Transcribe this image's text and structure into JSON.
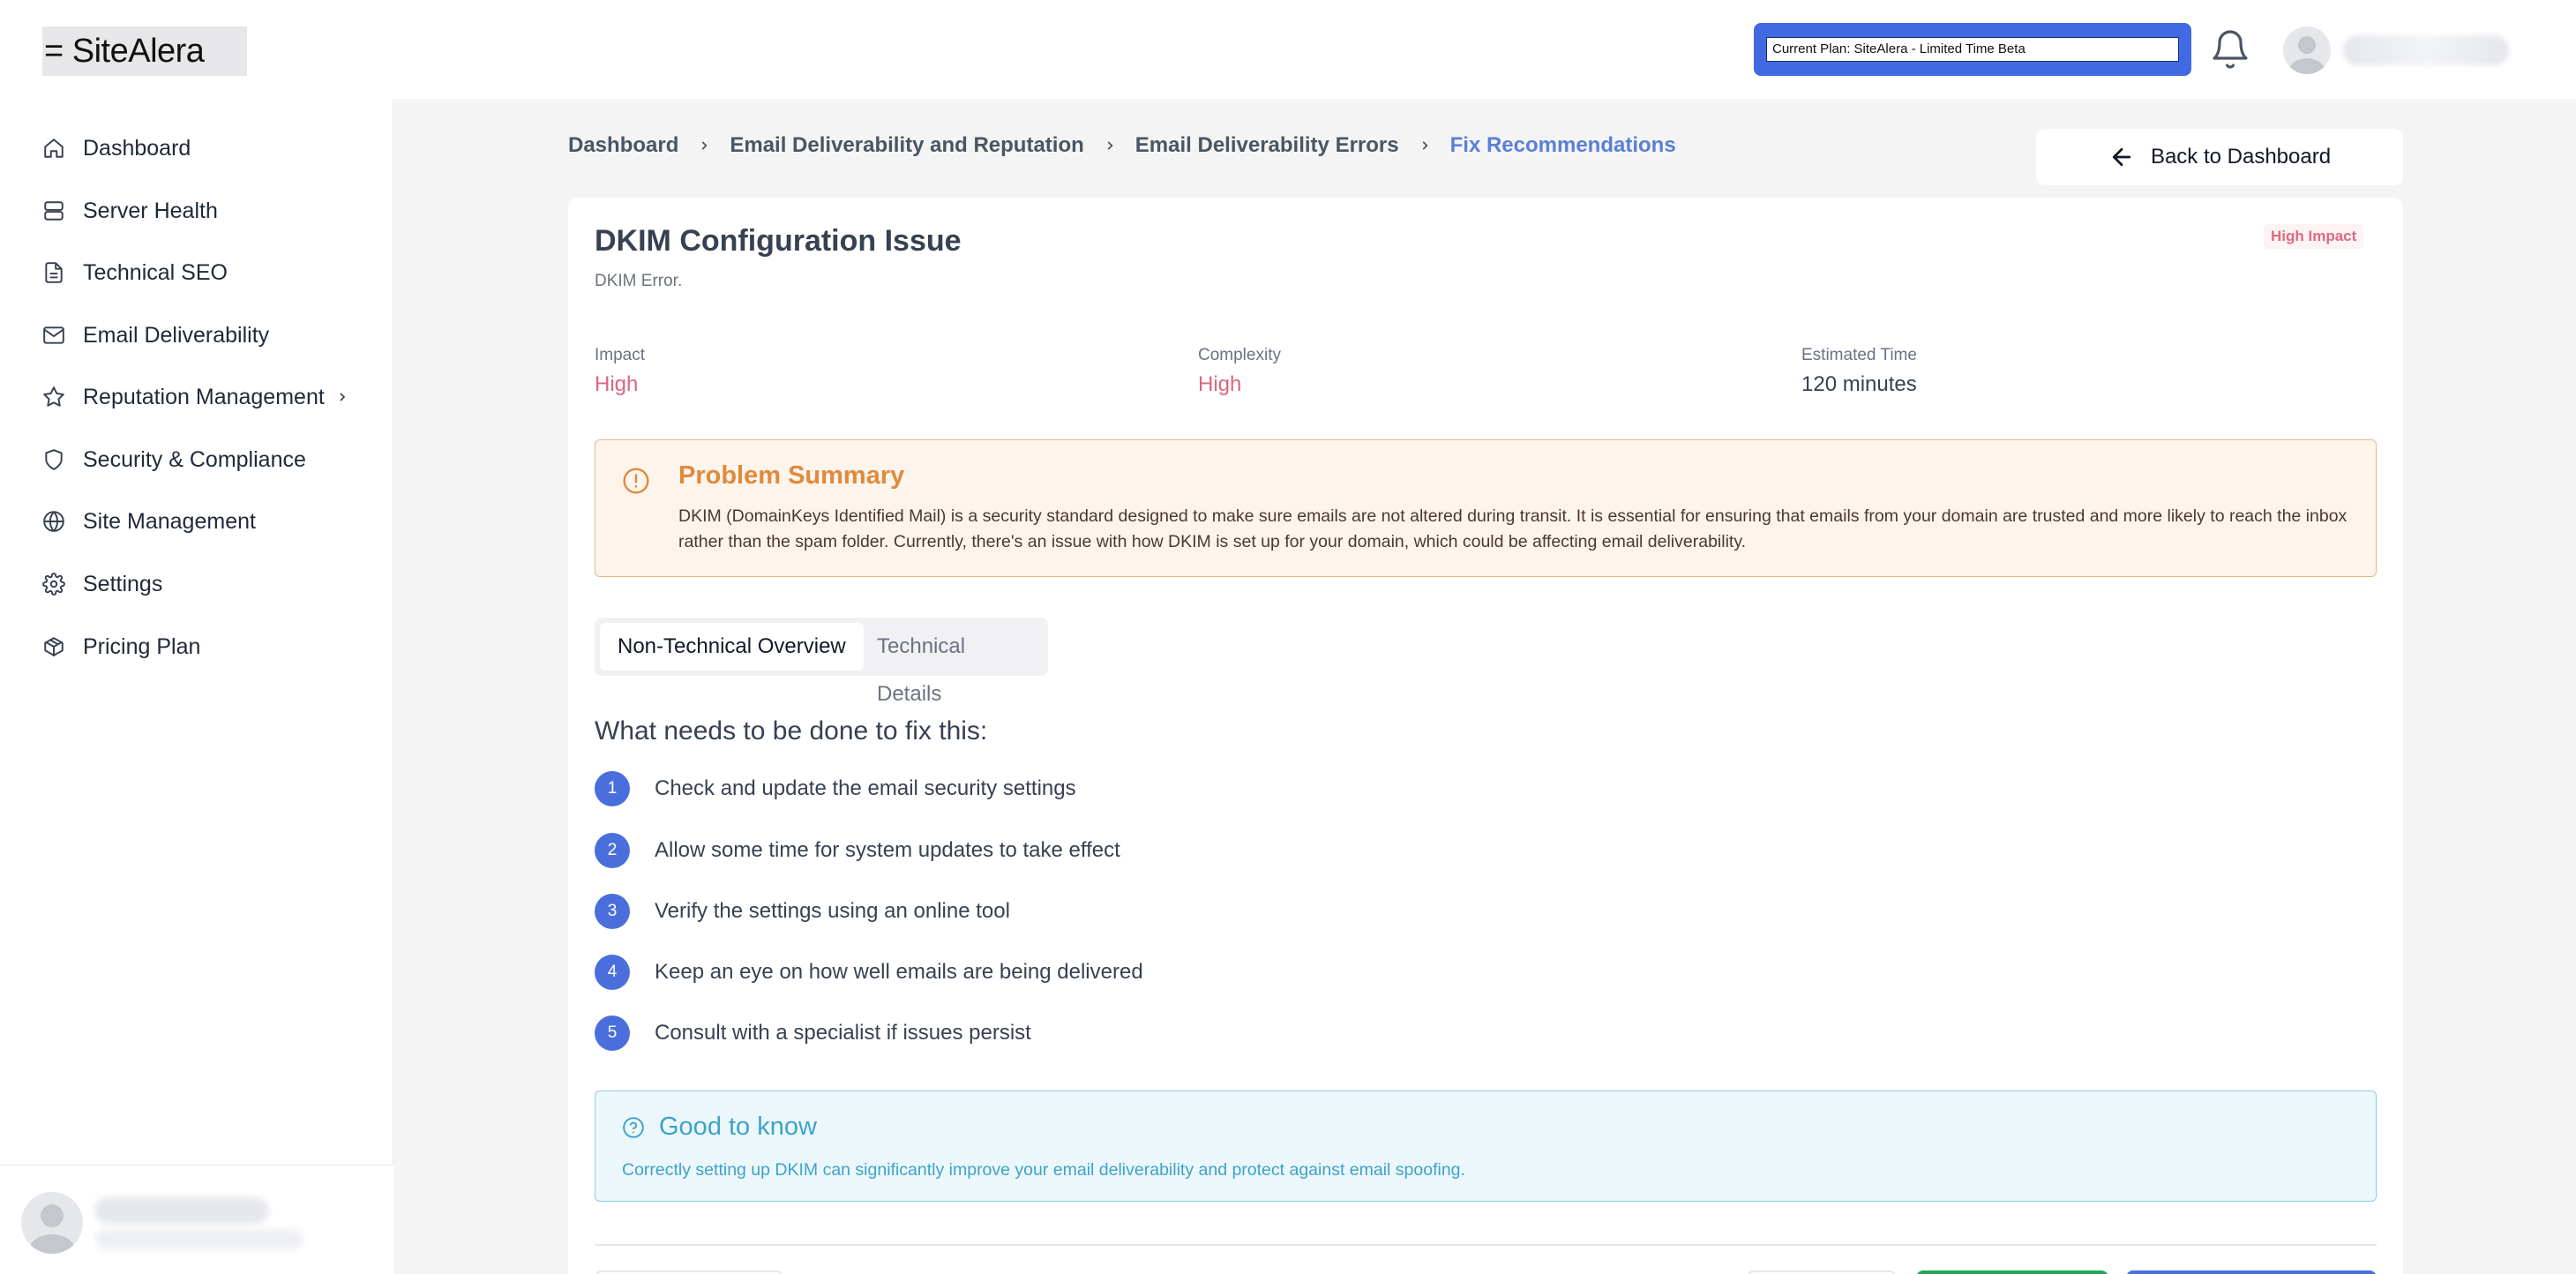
{
  "app": {
    "logo": "= SiteAlera"
  },
  "header": {
    "plan_label": "Current Plan: SiteAlera - Limited Time Beta"
  },
  "sidebar": {
    "items": [
      {
        "label": "Dashboard",
        "icon": "home-icon"
      },
      {
        "label": "Server Health",
        "icon": "server-icon"
      },
      {
        "label": "Technical SEO",
        "icon": "document-icon"
      },
      {
        "label": "Email Deliverability",
        "icon": "mail-icon"
      },
      {
        "label": "Reputation Management",
        "icon": "star-icon"
      },
      {
        "label": "Security & Compliance",
        "icon": "shield-icon"
      },
      {
        "label": "Site Management",
        "icon": "globe-icon"
      },
      {
        "label": "Settings",
        "icon": "gear-icon"
      },
      {
        "label": "Pricing Plan",
        "icon": "package-icon"
      }
    ]
  },
  "breadcrumb": {
    "items": [
      "Dashboard",
      "Email Deliverability and Reputation",
      "Email Deliverability Errors",
      "Fix Recommendations"
    ]
  },
  "back_button": "Back to Dashboard",
  "issue": {
    "title": "DKIM Configuration Issue",
    "subtitle": "DKIM Error.",
    "badge": "High Impact",
    "stats": {
      "impact_label": "Impact",
      "impact_value": "High",
      "complexity_label": "Complexity",
      "complexity_value": "High",
      "time_label": "Estimated Time",
      "time_value": "120 minutes"
    }
  },
  "problem": {
    "title": "Problem Summary",
    "text": "DKIM (DomainKeys Identified Mail) is a security standard designed to make sure emails are not altered during transit. It is essential for ensuring that emails from your domain are trusted and more likely to reach the inbox rather than the spam folder. Currently, there's an issue with how DKIM is set up for your domain, which could be affecting email deliverability."
  },
  "tabs": [
    "Non-Technical Overview",
    "Technical Details"
  ],
  "fix": {
    "title": "What needs to be done to fix this:",
    "steps": [
      {
        "num": "1",
        "text": "Check and update the email security settings"
      },
      {
        "num": "2",
        "text": "Allow some time for system updates to take effect"
      },
      {
        "num": "3",
        "text": "Verify the settings using an online tool"
      },
      {
        "num": "4",
        "text": "Keep an eye on how well emails are being delivered"
      },
      {
        "num": "5",
        "text": "Consult with a specialist if issues persist"
      }
    ]
  },
  "good_to_know": {
    "title": "Good to know",
    "text": "Correctly setting up DKIM can significantly improve your email deliverability and protect against email spoofing."
  },
  "colors": {
    "accent": "#4a6fdc",
    "plan_bg": "#4169e1",
    "high": "#d9667e",
    "warning": "#e08a3c",
    "info": "#3ca3c9"
  }
}
